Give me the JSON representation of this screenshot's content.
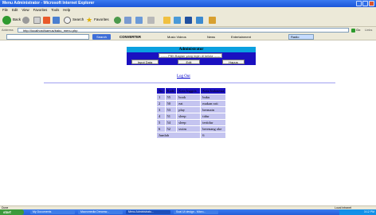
{
  "window": {
    "title": "Menu Administrator - Microsoft Internet Explorer"
  },
  "menu": [
    "File",
    "Edit",
    "View",
    "Favorites",
    "Tools",
    "Help"
  ],
  "toolbar": {
    "back_label": "Back",
    "search_label": "Search",
    "favorites_label": "Favorites"
  },
  "address": {
    "label": "Address",
    "url": "http://localhost/kamus/baku_menu.php",
    "go_label": "Go",
    "links_label": "Links"
  },
  "searchbar": {
    "search_button": "Search",
    "logo": "CONVERTER",
    "links": [
      "Music Videos",
      "News",
      "Entertainment",
      "Radio"
    ]
  },
  "page": {
    "title": "Administrator",
    "select_value": "------ Pilih Bagian yang ingin di kelola ------",
    "buttons": {
      "input": "Input Data",
      "edit": "Edit",
      "delete": "Hapus"
    },
    "logout": "Log Out"
  },
  "table": {
    "headers": [
      "No",
      "Kode",
      "Kata Inggris",
      "Kata Indonesia"
    ],
    "rows": [
      [
        "1",
        "55",
        "book",
        "buku"
      ],
      [
        "2",
        "50",
        "eat",
        "makan roti"
      ],
      [
        "3",
        "53",
        "play",
        "bermain"
      ],
      [
        "4",
        "51",
        "sleep",
        "tidur"
      ],
      [
        "5",
        "54",
        "sleep",
        "tertidur"
      ],
      [
        "6",
        "52",
        "swim",
        "berenang oke"
      ]
    ],
    "footer": [
      "Jumlah",
      "6"
    ]
  },
  "status": {
    "left": "Done",
    "right": "Local intranet"
  },
  "taskbar": {
    "start": "start",
    "tasks": [
      "My Documents",
      "Macromedia Dreamw...",
      "Menu Administrato...",
      "Soal UI design - Micro..."
    ],
    "clock": "3:12 PM"
  }
}
